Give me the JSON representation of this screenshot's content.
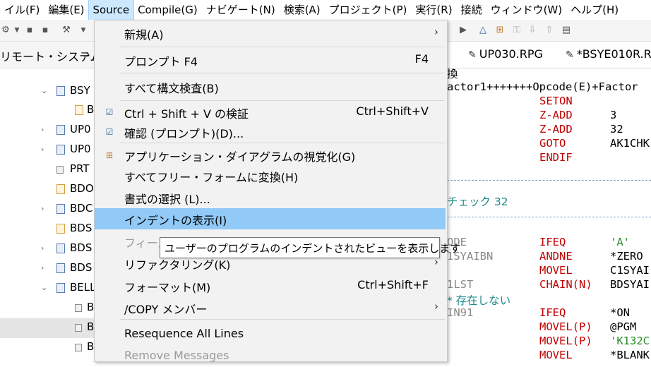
{
  "menubar": {
    "items": [
      "イル(F)",
      "編集(E)",
      "Source",
      "Compile(G)",
      "ナビゲート(N)",
      "検索(A)",
      "プロジェクト(P)",
      "実行(R)",
      "接続",
      "ウィンドウ(W)",
      "ヘルプ(H)"
    ],
    "active_index": 2
  },
  "left_panel": {
    "title": "リモート・システム",
    "tree": [
      "BSY",
      "B",
      "UP0",
      "UP0",
      "PRT",
      "BDO",
      "BDC",
      "BDS",
      "BDS",
      "BDS",
      "BELL",
      "B",
      "B",
      "B"
    ]
  },
  "editor": {
    "tabs": [
      "UP030.RPG",
      "*BSYE010R.R"
    ],
    "lines": {
      "l0": "換",
      "l1": "actor1+++++++Opcode(E)+Factor",
      "l2a": "SETON",
      "l3a": "Z-ADD",
      "l3b": "3",
      "l4a": "Z-ADD",
      "l4b": "32",
      "l5a": "GOTO",
      "l5b": "AK1CHK",
      "l6a": "ENDIF",
      "l7": "チェック 32",
      "l8a": "ODE",
      "l8b": "IFEQ",
      "l8c": "'A'",
      "l9a": "1SYAIBN",
      "l9b": "ANDNE",
      "l9c": "*ZERO",
      "l10b": "MOVEL",
      "l10c": "C1SYAI",
      "l11a": "1LST",
      "l11b": "CHAIN(N)",
      "l11c": "BDSYAI",
      "l12": "* 存在しない",
      "l13a": "IN91",
      "l13b": "IFEQ",
      "l13c": "*ON",
      "l14b": "MOVEL(P)",
      "l14c": "@PGM",
      "l15b": "MOVEL(P)",
      "l15c": "'K132C",
      "l16b": "MOVEL",
      "l16c": "*BLANK"
    }
  },
  "source_menu": {
    "items": [
      {
        "label": "新規(A)",
        "shortcut": "",
        "submenu": true
      },
      {
        "label": "プロンプト F4",
        "shortcut": "F4"
      },
      {
        "label": "すべて構文検査(B)",
        "shortcut": ""
      },
      {
        "label": "Ctrl + Shift + V の検証",
        "shortcut": "Ctrl+Shift+V"
      },
      {
        "label": "確認 (プロンプト)(D)...",
        "shortcut": ""
      },
      {
        "label": "アプリケーション・ダイアグラムの視覚化(G)",
        "shortcut": ""
      },
      {
        "label": "すべてフリー・フォームに変換(H)",
        "shortcut": ""
      },
      {
        "label": "書式の選択 (L)...",
        "shortcut": ""
      },
      {
        "label": "インデントの表示(I)",
        "shortcut": ""
      },
      {
        "label": "フィール",
        "shortcut": ""
      },
      {
        "label": "リファクタリング(K)",
        "shortcut": "",
        "submenu": true
      },
      {
        "label": "フォーマット(M)",
        "shortcut": "Ctrl+Shift+F"
      },
      {
        "label": "/COPY メンバー",
        "shortcut": "",
        "submenu": true
      },
      {
        "label": "Resequence All Lines",
        "shortcut": ""
      },
      {
        "label": "Remove Messages",
        "shortcut": ""
      }
    ],
    "highlighted_index": 8
  },
  "tooltip": "ユーザーのプログラムのインデントされたビューを表示します",
  "colors": {
    "highlight": "#91c9f7",
    "menubar_active": "#cce8ff",
    "keyword_red": "#c00000"
  }
}
